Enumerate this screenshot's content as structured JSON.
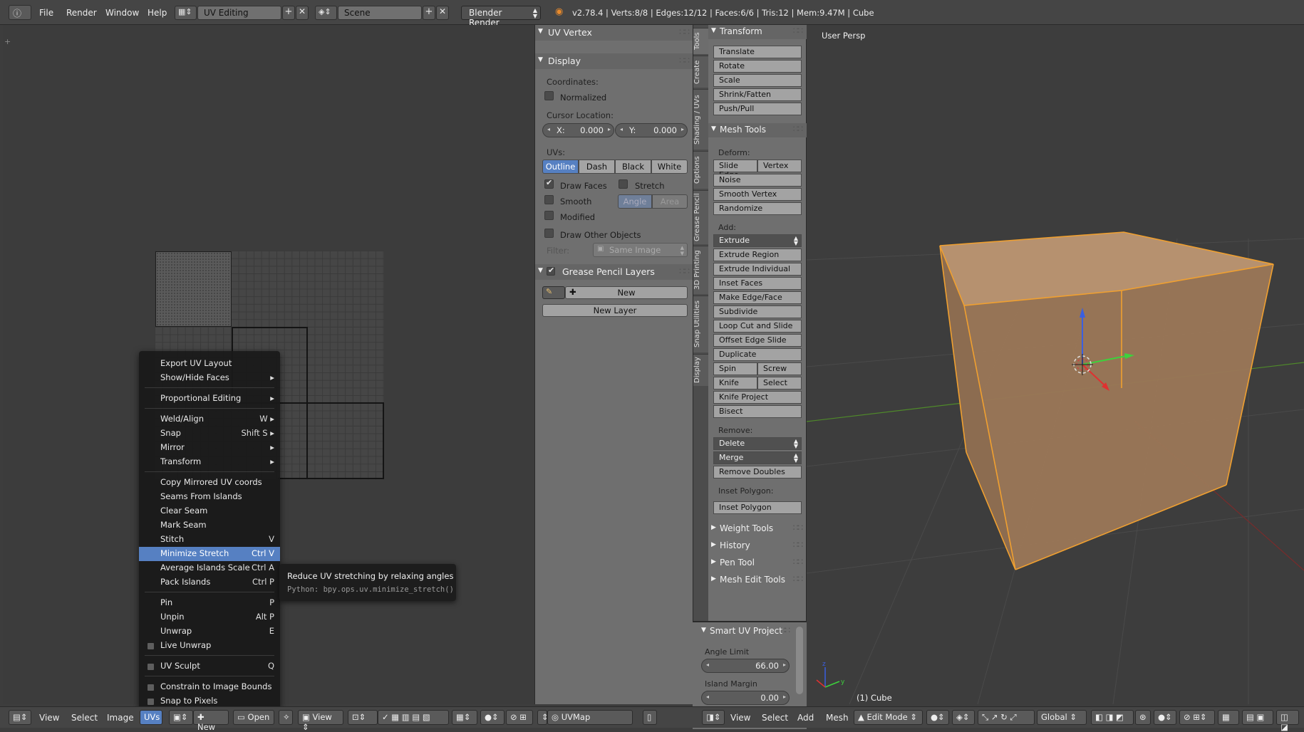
{
  "top_menu": {
    "items": [
      "File",
      "Render",
      "Window",
      "Help"
    ],
    "layout": "UV Editing",
    "scene": "Scene",
    "engine": "Blender Render",
    "info": "v2.78.4 | Verts:8/8 | Edges:12/12 | Faces:6/6 | Tris:12 | Mem:9.47M | Cube"
  },
  "uv_menu": {
    "items": [
      {
        "label": "Export UV Layout",
        "shortcut": ""
      },
      {
        "label": "Show/Hide Faces",
        "shortcut": "▸"
      },
      {
        "label": "Proportional Editing",
        "shortcut": "▸"
      },
      {
        "label": "Weld/Align",
        "shortcut": "W ▸"
      },
      {
        "label": "Snap",
        "shortcut": "Shift S ▸"
      },
      {
        "label": "Mirror",
        "shortcut": "▸"
      },
      {
        "label": "Transform",
        "shortcut": "▸"
      },
      {
        "label": "Copy Mirrored UV coords",
        "shortcut": ""
      },
      {
        "label": "Seams From Islands",
        "shortcut": ""
      },
      {
        "label": "Clear Seam",
        "shortcut": ""
      },
      {
        "label": "Mark Seam",
        "shortcut": ""
      },
      {
        "label": "Stitch",
        "shortcut": "V"
      },
      {
        "label": "Minimize Stretch",
        "shortcut": "Ctrl V"
      },
      {
        "label": "Average Islands Scale",
        "shortcut": "Ctrl A"
      },
      {
        "label": "Pack Islands",
        "shortcut": "Ctrl P"
      },
      {
        "label": "Pin",
        "shortcut": "P"
      },
      {
        "label": "Unpin",
        "shortcut": "Alt P"
      },
      {
        "label": "Unwrap",
        "shortcut": "E"
      },
      {
        "label": "Live Unwrap",
        "shortcut": ""
      },
      {
        "label": "UV Sculpt",
        "shortcut": "Q"
      },
      {
        "label": "Constrain to Image Bounds",
        "shortcut": ""
      },
      {
        "label": "Snap to Pixels",
        "shortcut": ""
      }
    ],
    "highlighted": "Minimize Stretch"
  },
  "tooltip": {
    "title": "Reduce UV stretching by relaxing angles",
    "python": "Python: bpy.ops.uv.minimize_stretch()"
  },
  "uv_panel": {
    "uv_vertex": "UV Vertex",
    "display": "Display",
    "coordinates": "Coordinates:",
    "normalized": "Normalized",
    "cursor_location": "Cursor Location:",
    "x_label": "X:",
    "x_value": "0.000",
    "y_label": "Y:",
    "y_value": "0.000",
    "uvs": "UVs:",
    "uv_styles": [
      "Outline",
      "Dash",
      "Black",
      "White"
    ],
    "draw_faces": "Draw Faces",
    "stretch": "Stretch",
    "smooth": "Smooth",
    "angle": "Angle",
    "area": "Area",
    "modified": "Modified",
    "draw_other": "Draw Other Objects",
    "filter": "Filter:",
    "filter_value": "Same Image",
    "grease_pencil": "Grease Pencil Layers",
    "new": "New",
    "new_layer": "New Layer"
  },
  "tool_tabs": [
    "Tools",
    "Create",
    "Shading / UVs",
    "Options",
    "Grease Pencil",
    "3D Printing",
    "Snap Utilities",
    "Display"
  ],
  "tool_shelf": {
    "transform": "Transform",
    "transform_btns": [
      "Translate",
      "Rotate",
      "Scale",
      "Shrink/Fatten",
      "Push/Pull"
    ],
    "mesh_tools": "Mesh Tools",
    "deform": "Deform:",
    "slide_edge": "Slide Edge",
    "vertex": "Vertex",
    "deform_btns": [
      "Noise",
      "Smooth Vertex",
      "Randomize"
    ],
    "add": "Add:",
    "extrude": "Extrude",
    "add_btns": [
      "Extrude Region",
      "Extrude Individual",
      "Inset Faces",
      "Make Edge/Face",
      "Subdivide",
      "Loop Cut and Slide",
      "Offset Edge Slide",
      "Duplicate"
    ],
    "spin": "Spin",
    "screw": "Screw",
    "knife": "Knife",
    "select": "Select",
    "knife_project": "Knife Project",
    "bisect": "Bisect",
    "remove": "Remove:",
    "delete": "Delete",
    "merge": "Merge",
    "remove_doubles": "Remove Doubles",
    "inset_polygon_lbl": "Inset Polygon:",
    "inset_polygon": "Inset Polygon",
    "collapsed": [
      "Weight Tools",
      "History",
      "Pen Tool",
      "Mesh Edit Tools"
    ],
    "smart_uv": "Smart UV Project",
    "angle_limit": "Angle Limit",
    "angle_value": "66.00",
    "island_margin": "Island Margin",
    "margin_value": "0.00"
  },
  "view3d": {
    "label": "User Persp",
    "object": "(1) Cube"
  },
  "uv_header": {
    "items": [
      "View",
      "Select",
      "Image",
      "UVs"
    ],
    "new": "New",
    "open": "Open",
    "view": "View",
    "uvmap": "UVMap"
  },
  "view3d_header": {
    "items": [
      "View",
      "Select",
      "Add",
      "Mesh"
    ],
    "mode": "Edit Mode",
    "orientation": "Global"
  },
  "colors": {
    "accent": "#5680c2",
    "cube_face": "#a07a59",
    "cube_edge": "#f0a030"
  }
}
